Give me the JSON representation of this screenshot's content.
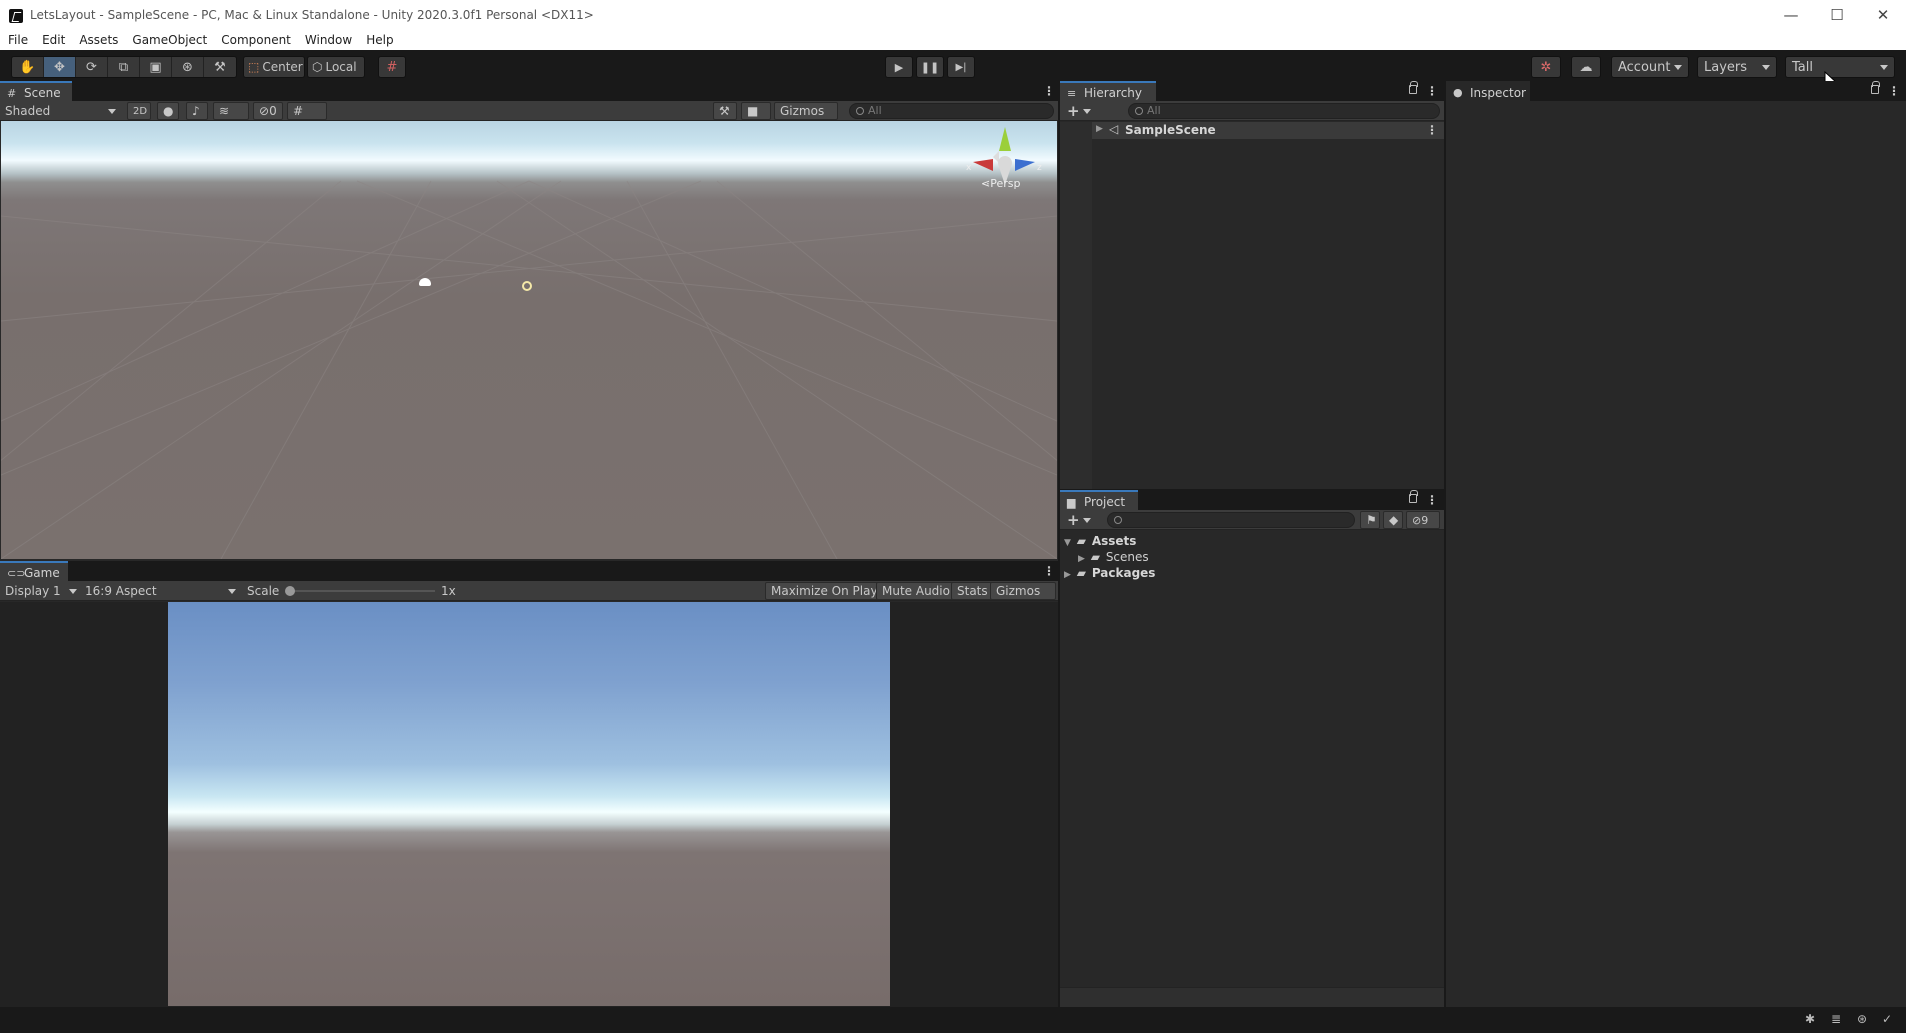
{
  "window": {
    "title": "LetsLayout - SampleScene - PC, Mac & Linux Standalone - Unity 2020.3.0f1 Personal <DX11>",
    "minimize": "—",
    "maximize": "☐",
    "close": "✕"
  },
  "menu": [
    "File",
    "Edit",
    "Assets",
    "GameObject",
    "Component",
    "Window",
    "Help"
  ],
  "toolbar": {
    "pivot_label": "Center",
    "space_label": "Local",
    "account_label": "Account",
    "layers_label": "Layers",
    "layout_label": "Tall"
  },
  "scene": {
    "tab_label": "Scene",
    "shading_mode": "Shaded",
    "mode_2d": "2D",
    "hidden_count": "0",
    "gizmos_label": "Gizmos",
    "search_placeholder": "All",
    "persp_label": "Persp",
    "axis_x": "x",
    "axis_y": "y",
    "axis_z": "z"
  },
  "game": {
    "tab_label": "Game",
    "display": "Display 1",
    "aspect": "16:9 Aspect",
    "scale_label": "Scale",
    "scale_value": "1x",
    "maximize_label": "Maximize On Play",
    "mute_label": "Mute Audio",
    "stats_label": "Stats",
    "gizmos_label": "Gizmos"
  },
  "hierarchy": {
    "tab_label": "Hierarchy",
    "search_placeholder": "All",
    "items": [
      {
        "label": "SampleScene"
      }
    ]
  },
  "project": {
    "tab_label": "Project",
    "hidden_count": "9",
    "tree": [
      {
        "label": "Assets"
      },
      {
        "label": "Scenes"
      },
      {
        "label": "Packages"
      }
    ]
  },
  "inspector": {
    "tab_label": "Inspector"
  },
  "colors": {
    "accent_tab": "#3a79bb",
    "panel_bg": "#282828",
    "toolbar_bg": "#191919"
  }
}
